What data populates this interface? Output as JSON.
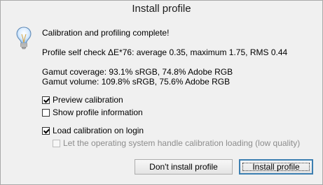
{
  "window": {
    "title": "Install profile"
  },
  "content": {
    "icon": "lightbulb-icon",
    "headline": "Calibration and profiling complete!",
    "self_check": "Profile self check ΔE*76: average 0.35, maximum 1.75, RMS 0.44",
    "gamut_coverage": "Gamut coverage: 93.1% sRGB, 74.8% Adobe RGB",
    "gamut_volume": "Gamut volume: 109.8% sRGB, 75.6% Adobe RGB"
  },
  "options": {
    "preview_calibration": {
      "label": "Preview calibration",
      "checked": true
    },
    "show_profile_info": {
      "label": "Show profile information",
      "checked": false
    },
    "load_calibration": {
      "label": "Load calibration on login",
      "checked": true
    },
    "os_calibration_loading": {
      "label": "Let the operating system handle calibration loading (low quality)",
      "checked": false,
      "disabled": true
    }
  },
  "buttons": {
    "dont_install": "Don't install profile",
    "install": "Install profile"
  },
  "colors": {
    "window_bg": "#f0f0f0",
    "default_button_border": "#3c7fb1"
  }
}
